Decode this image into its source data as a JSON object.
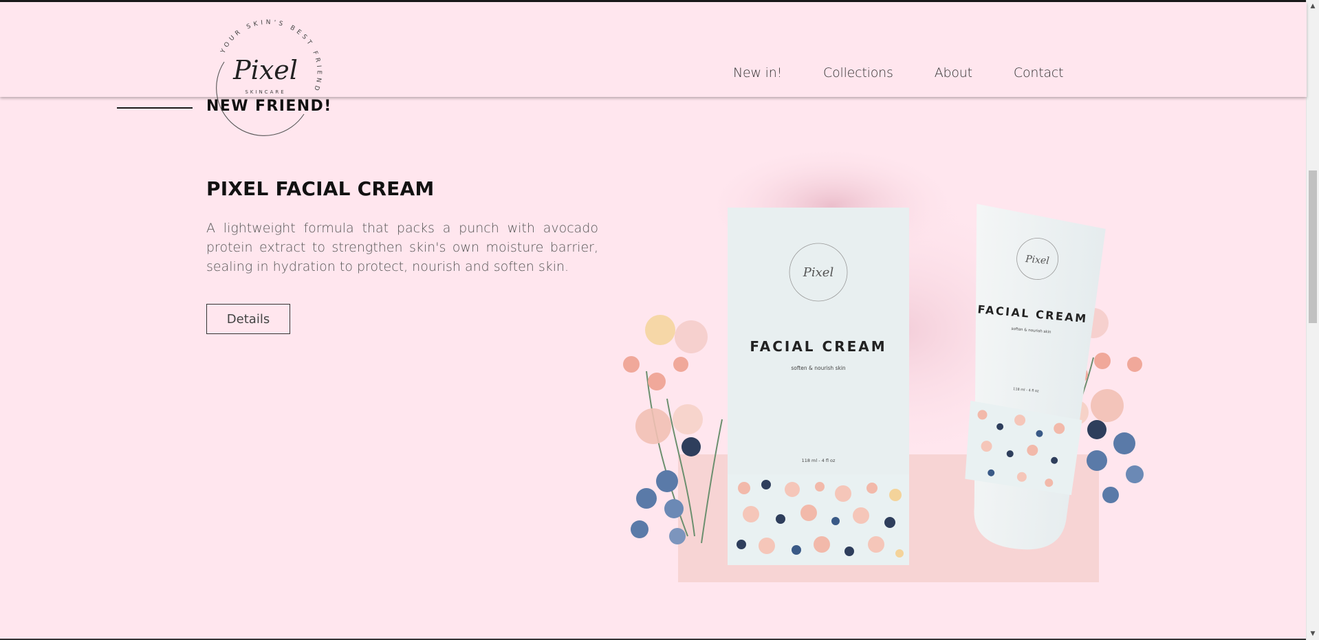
{
  "brand": {
    "name": "Pixel",
    "sub": "SKINCARE",
    "tagline": "YOUR SKIN'S BEST FRIEND"
  },
  "nav": {
    "items": [
      {
        "label": "New in!"
      },
      {
        "label": "Collections"
      },
      {
        "label": "About"
      },
      {
        "label": "Contact"
      }
    ]
  },
  "section": {
    "heading": "NEW FRIEND!"
  },
  "product": {
    "title": "PIXEL FACIAL CREAM",
    "description": "A lightweight formula that packs a punch with avocado protein extract to strengthen skin's own moisture barrier, sealing in hydration to protect, nourish and soften skin.",
    "details_label": "Details",
    "packaging": {
      "box_title": "FACIAL CREAM",
      "box_subtitle": "soften & nourish skin",
      "box_volume": "118 ml - 4 fl oz",
      "tube_title": "FACIAL CREAM",
      "tube_subtitle": "soften & nourish skin",
      "tube_volume": "118 ml - 4 fl oz"
    }
  },
  "colors": {
    "background": "#ffe6ee",
    "text_dark": "#111111",
    "pedestal": "#f7d4d4",
    "packaging": "#e8eff0"
  },
  "icons": {
    "scroll_up": "triangle-up-icon",
    "scroll_down": "triangle-down-icon"
  }
}
